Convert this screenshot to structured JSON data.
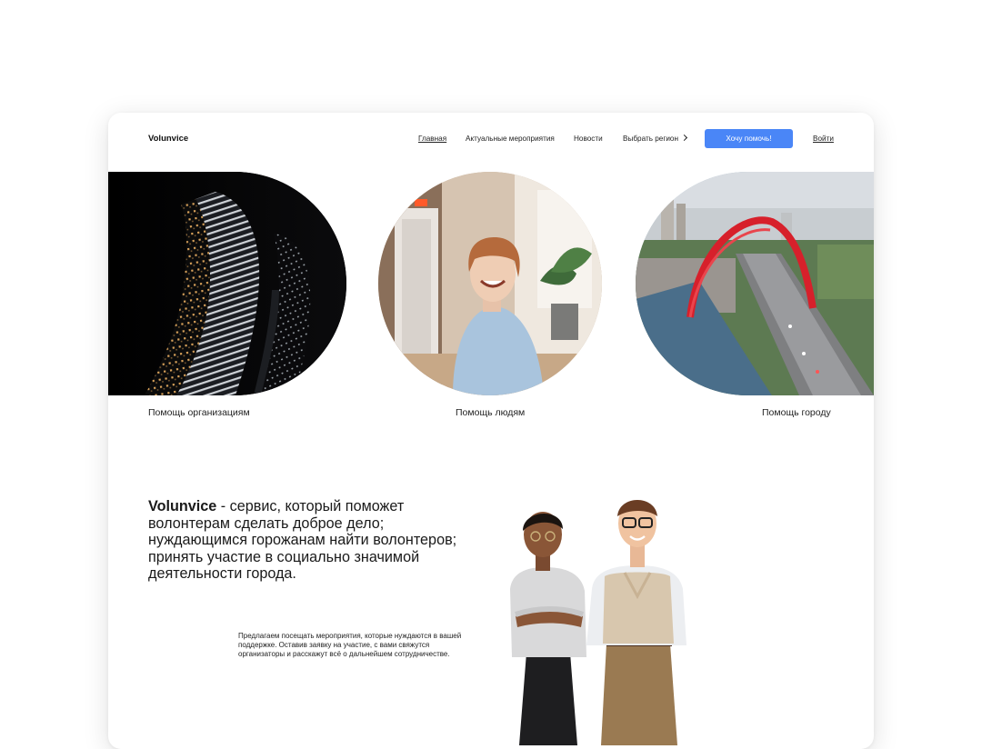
{
  "header": {
    "logo": "Volunvice",
    "nav": {
      "home": "Главная",
      "events": "Актуальные мероприятия",
      "news": "Новости",
      "region": "Выбрать регион"
    },
    "cta_label": "Хочу помочь!",
    "login": "Войти"
  },
  "categories": [
    {
      "label": "Помощь организациям",
      "image_icon": "skyscraper-photo"
    },
    {
      "label": "Помощь людям",
      "image_icon": "smiling-woman-photo"
    },
    {
      "label": "Помощь городу",
      "image_icon": "red-arch-bridge-photo"
    }
  ],
  "about": {
    "brand": "Volunvice",
    "headline_rest": " - сервис, который поможет волонтерам сделать доброе дело; нуждающимся горожанам найти волонтеров; принять участие в социально значимой деятельности города.",
    "description": "Предлагаем посещать мероприятия, которые нуждаются в вашей поддержке. Оставив заявку на участие, с вами свяжутся организаторы и расскажут всё о дальнейшем сотрудничестве."
  },
  "colors": {
    "accent": "#4a86f7",
    "background": "#ffffff",
    "text": "#1a1a1a"
  }
}
